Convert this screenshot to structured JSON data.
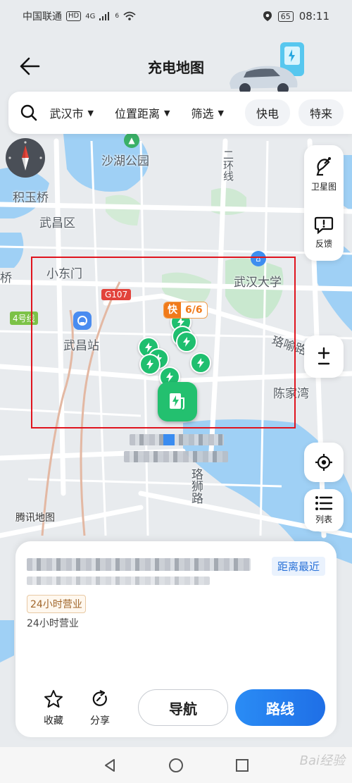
{
  "status_bar": {
    "carrier": "中国联通",
    "hd": "HD",
    "signal": "4G",
    "wifi_sub": "6",
    "battery": "65",
    "time": "08:11"
  },
  "header": {
    "title": "充电地图"
  },
  "filters": {
    "city": "武汉市",
    "distance": "位置距离",
    "filter": "筛选",
    "pills": [
      "快电",
      "特来"
    ]
  },
  "side": {
    "satellite": "卫星图",
    "feedback": "反馈",
    "zoom": "±",
    "list": "列表"
  },
  "map_labels": {
    "shahu": "沙湖公园",
    "jiyuqiao": "积玉桥",
    "wuchang_district": "武昌区",
    "xiaodongmen": "小东门",
    "wuhan_univ": "武汉大学",
    "g107": "G107",
    "line4": "4号线",
    "wuchang_station": "武昌站",
    "luoyu_road": "珞喻路",
    "chenjiawan": "陈家湾",
    "luoshi_road": "珞狮路",
    "erhuan": "二环线",
    "qiao": "桥",
    "tencent": "腾讯地图"
  },
  "fast_badge": {
    "kind": "快",
    "count": "6/6"
  },
  "card": {
    "distance_tag": "距离最近",
    "hours_tag": "24小时营业",
    "hours_text": "24小时营业",
    "favorite": "收藏",
    "share": "分享",
    "navigate": "导航",
    "route": "路线"
  },
  "watermark": "Bai经验",
  "colors": {
    "accent_blue": "#1f6fe6",
    "charger_green": "#1fbf6f",
    "fast_orange": "#f07a1a",
    "highlight_red": "#e0141e"
  }
}
